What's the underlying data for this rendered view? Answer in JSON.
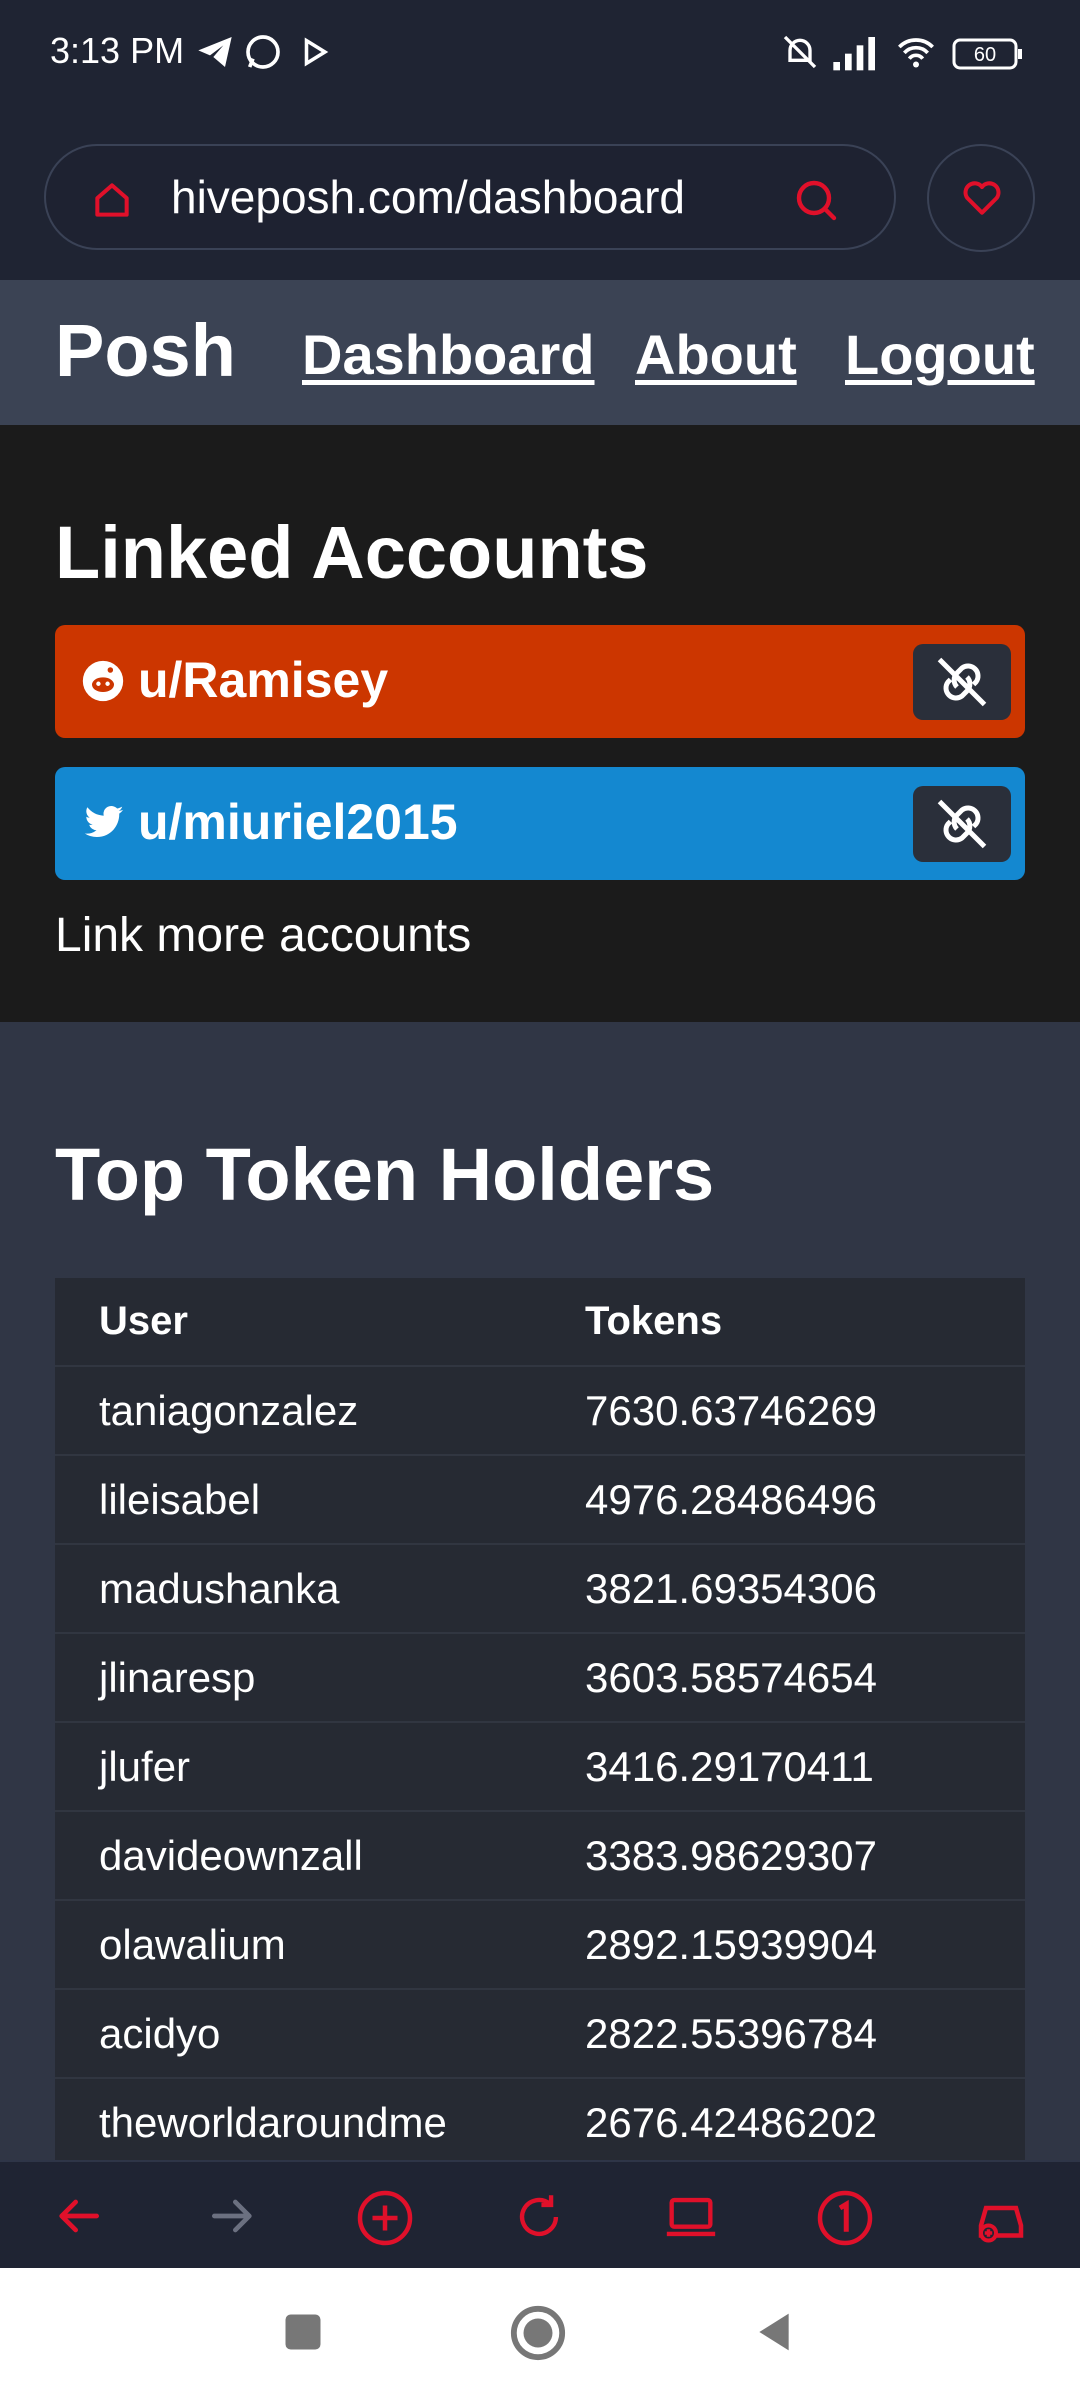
{
  "status": {
    "time": "3:13 PM",
    "battery": "60"
  },
  "browser": {
    "url": "hiveposh.com/dashboard"
  },
  "nav": {
    "brand": "Posh",
    "links": [
      "Dashboard",
      "About",
      "Logout"
    ]
  },
  "linked": {
    "title": "Linked Accounts",
    "accounts": [
      {
        "service": "reddit",
        "name": "u/Ramisey",
        "color": "#cc3600"
      },
      {
        "service": "twitter",
        "name": "u/miuriel2015",
        "color": "#1488d0"
      }
    ],
    "more": "Link more accounts"
  },
  "holders": {
    "title": "Top Token Holders",
    "columns": [
      "User",
      "Tokens"
    ],
    "rows": [
      [
        "taniagonzalez",
        "7630.63746269"
      ],
      [
        "lileisabel",
        "4976.28486496"
      ],
      [
        "madushanka",
        "3821.69354306"
      ],
      [
        "jlinaresp",
        "3603.58574654"
      ],
      [
        "jlufer",
        "3416.29170411"
      ],
      [
        "davideownzall",
        "3383.98629307"
      ],
      [
        "olawalium",
        "2892.15939904"
      ],
      [
        "acidyo",
        "2822.55396784"
      ],
      [
        "theworldaroundme",
        "2676.42486202"
      ]
    ]
  },
  "theme": {
    "accent": "#e0102a"
  }
}
